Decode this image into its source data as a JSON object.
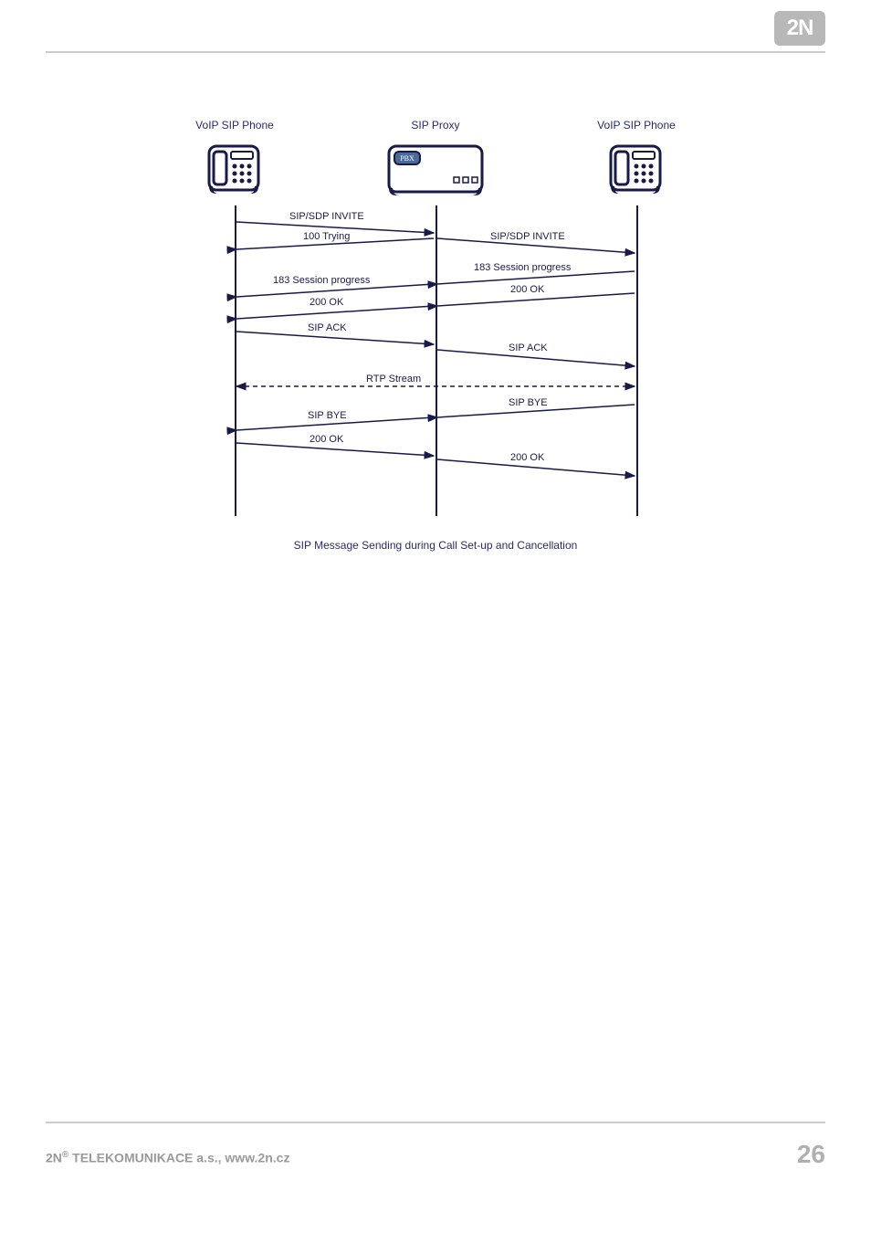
{
  "brand": {
    "logo_text": "2N"
  },
  "diagram": {
    "actors": {
      "left": "VoIP SIP Phone",
      "center": "SIP Proxy",
      "right": "VoIP SIP Phone"
    },
    "proxy_badge": "PBX",
    "messages": {
      "m1": "SIP/SDP INVITE",
      "m2": "100 Trying",
      "m3": "SIP/SDP INVITE",
      "m4": "183 Session progress",
      "m5": "183 Session progress",
      "m6": "200 OK",
      "m7": "200 OK",
      "m8": "SIP ACK",
      "m9": "SIP ACK",
      "m10": "RTP Stream",
      "m11": "SIP BYE",
      "m12": "SIP BYE",
      "m13": "200 OK",
      "m14": "200 OK"
    },
    "caption": "SIP Message Sending during Call Set-up and Cancellation"
  },
  "footer": {
    "company_prefix": "2N",
    "company_reg": "®",
    "company_rest": " TELEKOMUNIKACE a.s., www.2n.cz",
    "page_number": "26"
  }
}
